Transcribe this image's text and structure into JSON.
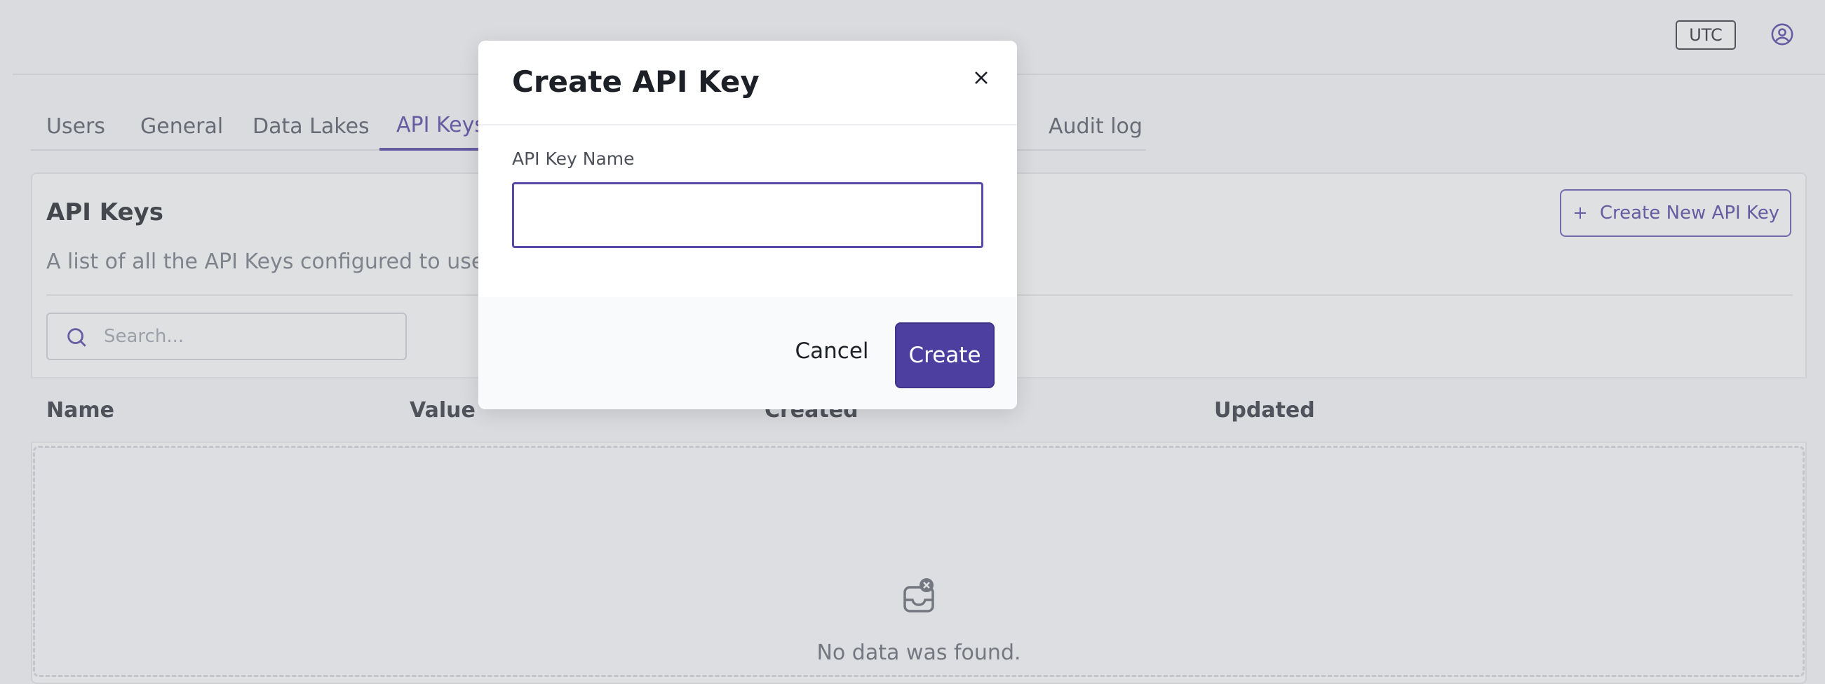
{
  "header": {
    "timezone_label": "UTC",
    "user_icon": "user-circle-icon"
  },
  "tabs": [
    {
      "label": "Users",
      "active": false
    },
    {
      "label": "General",
      "active": false
    },
    {
      "label": "Data Lakes",
      "active": false
    },
    {
      "label": "API Keys",
      "active": true
    },
    {
      "label": "Audit log",
      "active": false
    }
  ],
  "section": {
    "title": "API Keys",
    "description": "A list of all the API Keys configured to use the",
    "create_button_label": "Create New API Key",
    "create_button_icon": "plus-icon"
  },
  "search": {
    "placeholder": "Search...",
    "value": ""
  },
  "table": {
    "columns": [
      "Name",
      "Value",
      "Created",
      "Updated"
    ],
    "rows": [],
    "empty_text": "No data was found.",
    "empty_icon": "empty-inbox-icon"
  },
  "modal": {
    "title": "Create API Key",
    "field_label": "API Key Name",
    "field_value": "",
    "cancel_label": "Cancel",
    "submit_label": "Create"
  },
  "colors": {
    "accent": "#5848a7",
    "primary_button": "#4d3f9f"
  }
}
